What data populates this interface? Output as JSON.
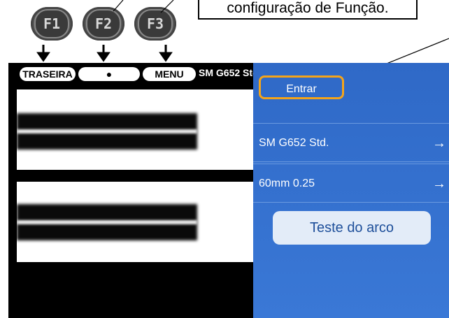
{
  "function_keys": [
    {
      "label": "F1"
    },
    {
      "label": "F2"
    },
    {
      "label": "F3"
    }
  ],
  "callout_text": "configuração de Função.",
  "soft_keys": {
    "back_label": "TRASEIRA",
    "middle_symbol": "●",
    "menu_label": "MENU"
  },
  "fiber_label": "SM G652 Std.",
  "menu_panel": {
    "enter_label": "Entrar",
    "rows": [
      {
        "label": "SM G652 Std.",
        "arrow": "→"
      },
      {
        "label": "60mm 0.25",
        "arrow": "→"
      }
    ],
    "arc_test_label": "Teste do arco"
  },
  "colors": {
    "panel_blue": "#3a78d6",
    "enter_highlight": "#f4a41a",
    "arc_button_bg": "#e3ecf8"
  }
}
